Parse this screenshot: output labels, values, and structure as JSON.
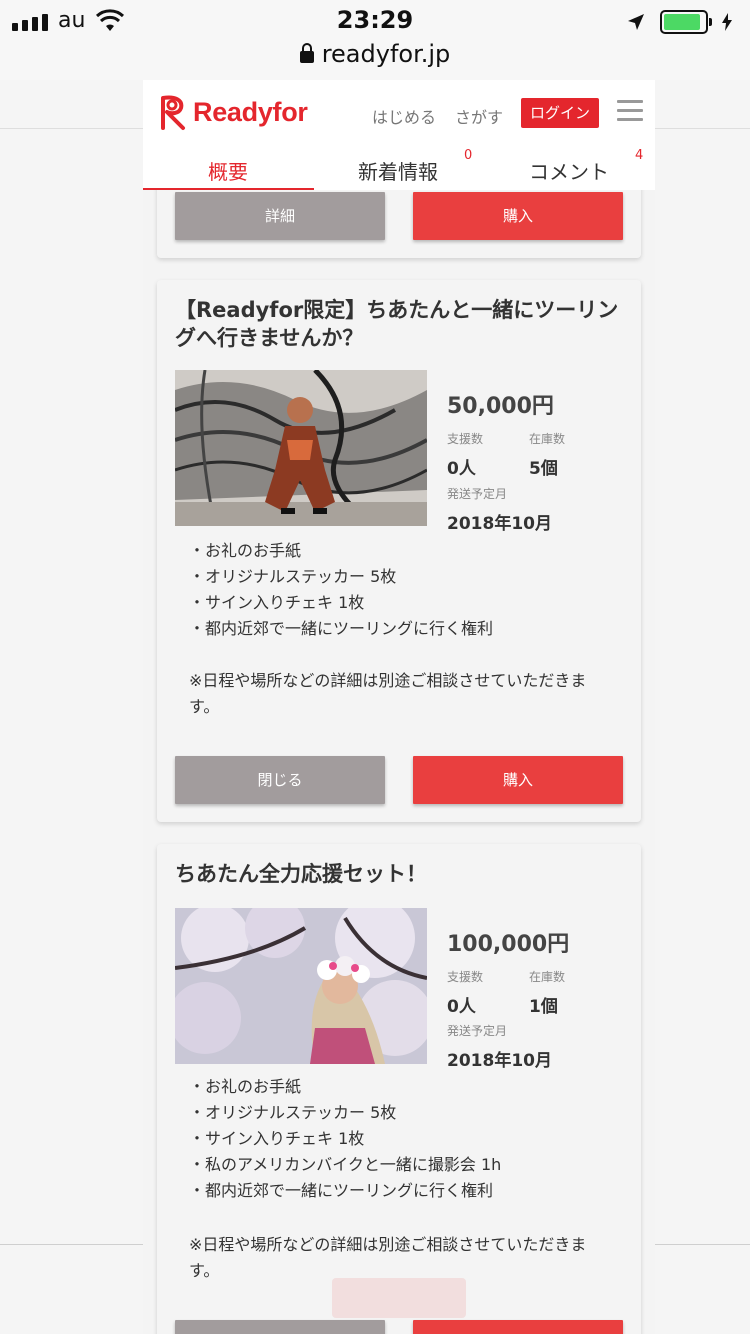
{
  "status_bar": {
    "carrier": "au",
    "time": "23:29",
    "url": "readyfor.jp"
  },
  "header": {
    "logo_text": "Readyfor",
    "nav_start": "はじめる",
    "nav_search": "さがす",
    "login": "ログイン"
  },
  "tabs": [
    {
      "label": "概要",
      "badge": ""
    },
    {
      "label": "新着情報",
      "badge": "0"
    },
    {
      "label": "コメント",
      "badge": "4"
    }
  ],
  "card0": {
    "detail_button": "詳細",
    "buy_button": "購入"
  },
  "card1": {
    "title": "【Readyfor限定】ちあたんと一緒にツーリングへ行きませんか？",
    "price": "50,000円",
    "supporters_label": "支援数",
    "supporters": "0人",
    "stock_label": "在庫数",
    "stock": "5個",
    "ship_label": "発送予定月",
    "ship": "2018年10月",
    "items": [
      "・お礼のお手紙",
      "・オリジナルステッカー 5枚",
      "・サイン入りチェキ 1枚",
      "・都内近郊で一緒にツーリングに行く権利"
    ],
    "note": "※日程や場所などの詳細は別途ご相談させていただきます。",
    "close_button": "閉じる",
    "buy_button": "購入"
  },
  "card2": {
    "title": "ちあたん全力応援セット！",
    "price": "100,000円",
    "supporters_label": "支援数",
    "supporters": "0人",
    "stock_label": "在庫数",
    "stock": "1個",
    "ship_label": "発送予定月",
    "ship": "2018年10月",
    "items": [
      "・お礼のお手紙",
      "・オリジナルステッカー 5枚",
      "・サイン入りチェキ 1枚",
      "・私のアメリカンバイクと一緒に撮影会 1h",
      "・都内近郊で一緒にツーリングに行く権利"
    ],
    "note": "※日程や場所などの詳細は別途ご相談させていただきます。"
  },
  "colors": {
    "brand_red": "#e4262d",
    "button_red": "#e93f3f",
    "button_grey": "#a29c9d"
  }
}
